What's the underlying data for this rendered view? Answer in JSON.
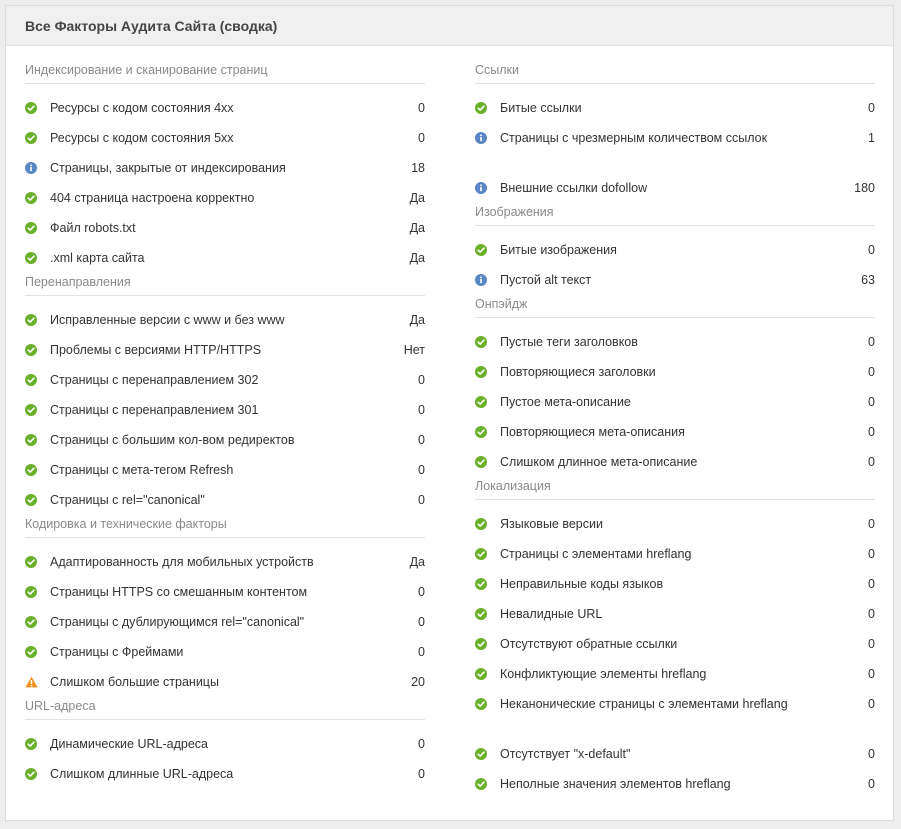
{
  "header": {
    "title": "Все Факторы Аудита Сайта (сводка)"
  },
  "colors": {
    "ok": "#6ab02a",
    "info": "#5b86c6",
    "warn": "#f0901e"
  },
  "left_sections": [
    {
      "title": "Индексирование и сканирование страниц",
      "items": [
        {
          "label": "Ресурсы с кодом состояния 4xx",
          "value": "0",
          "icon": "check-icon"
        },
        {
          "label": "Ресурсы с кодом состояния 5xx",
          "value": "0",
          "icon": "check-icon"
        },
        {
          "label": "Страницы, закрытые от индексирования",
          "value": "18",
          "icon": "info-icon"
        },
        {
          "label": "404 страница настроена корректно",
          "value": "Да",
          "icon": "check-icon"
        },
        {
          "label": "Файл robots.txt",
          "value": "Да",
          "icon": "check-icon"
        },
        {
          "label": ".xml карта сайта",
          "value": "Да",
          "icon": "check-icon"
        }
      ]
    },
    {
      "title": "Перенаправления",
      "items": [
        {
          "label": "Исправленные версии с www и без www",
          "value": "Да",
          "icon": "check-icon"
        },
        {
          "label": "Проблемы с версиями HTTP/HTTPS",
          "value": "Нет",
          "icon": "check-icon"
        },
        {
          "label": "Страницы с перенаправлением 302",
          "value": "0",
          "icon": "check-icon"
        },
        {
          "label": "Страницы с перенаправлением 301",
          "value": "0",
          "icon": "check-icon"
        },
        {
          "label": "Страницы с большим кол-вом редиректов",
          "value": "0",
          "icon": "check-icon"
        },
        {
          "label": "Страницы с мета-тегом Refresh",
          "value": "0",
          "icon": "check-icon"
        },
        {
          "label": "Страницы с rel=\"canonical\"",
          "value": "0",
          "icon": "check-icon"
        }
      ]
    },
    {
      "title": "Кодировка и технические факторы",
      "items": [
        {
          "label": "Адаптированность для мобильных устройств",
          "value": "Да",
          "icon": "check-icon"
        },
        {
          "label": "Страницы HTTPS со смешанным контентом",
          "value": "0",
          "icon": "check-icon"
        },
        {
          "label": "Страницы с дублирующимся rel=\"canonical\"",
          "value": "0",
          "icon": "check-icon"
        },
        {
          "label": "Страницы с Фреймами",
          "value": "0",
          "icon": "check-icon"
        },
        {
          "label": "Слишком большие страницы",
          "value": "20",
          "icon": "warning-icon"
        }
      ]
    },
    {
      "title": "URL-адреса",
      "items": [
        {
          "label": "Динамические URL-адреса",
          "value": "0",
          "icon": "check-icon"
        },
        {
          "label": "Слишком длинные URL-адреса",
          "value": "0",
          "icon": "check-icon"
        }
      ]
    }
  ],
  "right_sections": [
    {
      "title": "Ссылки",
      "items": [
        {
          "label": "Битые ссылки",
          "value": "0",
          "icon": "check-icon"
        },
        {
          "label": "Страницы с чрезмерным количеством ссылок",
          "value": "1",
          "icon": "info-icon",
          "multiline": true
        },
        {
          "label": "Внешние ссылки dofollow",
          "value": "180",
          "icon": "info-icon"
        }
      ]
    },
    {
      "title": "Изображения",
      "items": [
        {
          "label": "Битые изображения",
          "value": "0",
          "icon": "check-icon"
        },
        {
          "label": "Пустой alt текст",
          "value": "63",
          "icon": "info-icon"
        }
      ]
    },
    {
      "title": "Онпэйдж",
      "items": [
        {
          "label": "Пустые теги заголовков",
          "value": "0",
          "icon": "check-icon"
        },
        {
          "label": "Повторяющиеся заголовки",
          "value": "0",
          "icon": "check-icon"
        },
        {
          "label": "Пустое мета-описание",
          "value": "0",
          "icon": "check-icon"
        },
        {
          "label": "Повторяющиеся мета-описания",
          "value": "0",
          "icon": "check-icon"
        },
        {
          "label": "Слишком длинное мета-описание",
          "value": "0",
          "icon": "check-icon"
        }
      ]
    },
    {
      "title": "Локализация",
      "items": [
        {
          "label": "Языковые версии",
          "value": "0",
          "icon": "check-icon"
        },
        {
          "label": "Страницы с элементами hreflang",
          "value": "0",
          "icon": "check-icon"
        },
        {
          "label": "Неправильные коды языков",
          "value": "0",
          "icon": "check-icon"
        },
        {
          "label": "Невалидные URL",
          "value": "0",
          "icon": "check-icon"
        },
        {
          "label": "Отсутствуют обратные ссылки",
          "value": "0",
          "icon": "check-icon"
        },
        {
          "label": "Конфликтующие элементы hreflang",
          "value": "0",
          "icon": "check-icon"
        },
        {
          "label": "Неканонические страницы с элементами hreflang",
          "value": "0",
          "icon": "check-icon",
          "multiline": true
        },
        {
          "label": "Отсутствует \"x-default\"",
          "value": "0",
          "icon": "check-icon"
        },
        {
          "label": "Неполные значения элементов hreflang",
          "value": "0",
          "icon": "check-icon"
        }
      ]
    }
  ]
}
